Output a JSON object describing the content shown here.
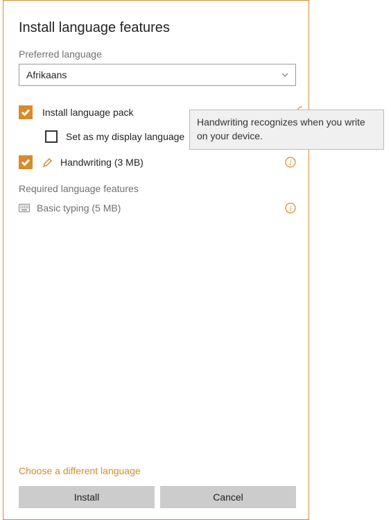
{
  "title": "Install language features",
  "preferred_label": "Preferred language",
  "selected_language": "Afrikaans",
  "features": {
    "language_pack": {
      "label": "Install language pack",
      "checked": true
    },
    "display_language": {
      "label": "Set as my display language",
      "checked": false
    },
    "handwriting": {
      "label": "Handwriting (3 MB)",
      "checked": true
    }
  },
  "required_section": "Required language features",
  "required": {
    "basic_typing": {
      "label": "Basic typing (5 MB)"
    }
  },
  "link": "Choose a different language",
  "buttons": {
    "install": "Install",
    "cancel": "Cancel"
  },
  "tooltip": "Handwriting recognizes when you write on your device."
}
